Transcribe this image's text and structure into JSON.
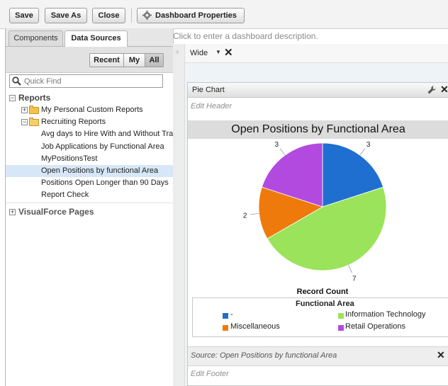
{
  "toolbar": {
    "save": "Save",
    "save_as": "Save As",
    "close": "Close",
    "dashboard_properties": "Dashboard Properties"
  },
  "left_panel": {
    "tabs": [
      "Components",
      "Data Sources"
    ],
    "active_tab": "Data Sources",
    "filter_buttons": [
      "Recent",
      "My",
      "All"
    ],
    "active_filter": "All",
    "quick_find_placeholder": "Quick Find",
    "tree": {
      "reports_label": "Reports",
      "folders": [
        "My Personal Custom Reports",
        "Recruiting Reports"
      ],
      "reports": [
        "Avg days to Hire With and Without Travel",
        "Job Applications by Functional Area",
        "MyPositionsTest",
        "Open Positions by functional Area",
        "Positions Open Longer than 90 Days",
        "Report Check"
      ],
      "selected_report": "Open Positions by functional Area",
      "visualforce_label": "VisualForce Pages"
    }
  },
  "main": {
    "description_placeholder": "Click to enter a dashboard description.",
    "column_width": "Wide",
    "component": {
      "type_label": "Pie Chart",
      "edit_header": "Edit Header",
      "title": "Open Positions by Functional Area",
      "source": "Source: Open Positions by functional Area",
      "edit_footer": "Edit Footer"
    }
  },
  "chart_data": {
    "type": "pie",
    "title": "Open Positions by Functional Area",
    "value_label": "Record Count",
    "legend_title": "Functional Area",
    "legend_placement": "bottom",
    "start_angle_deg": 0,
    "direction": "clockwise",
    "slices": [
      {
        "label": "-",
        "value": 3,
        "color": "#1f6fd1"
      },
      {
        "label": "Information Technology",
        "value": 7,
        "color": "#9be35a"
      },
      {
        "label": "Miscellaneous",
        "value": 2,
        "color": "#ef7a0c"
      },
      {
        "label": "Retail Operations",
        "value": 3,
        "color": "#b34adf"
      }
    ]
  }
}
